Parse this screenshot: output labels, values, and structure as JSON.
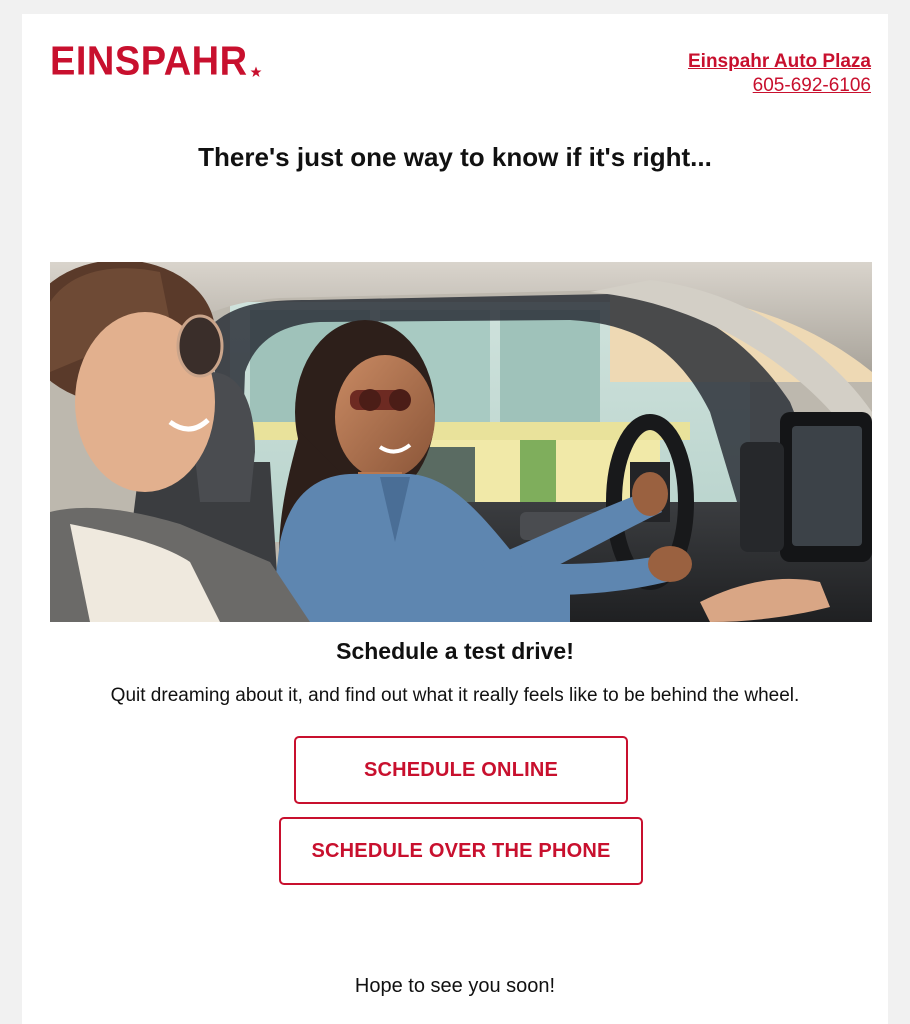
{
  "header": {
    "logo_text": "EINSPAHR",
    "dealer_name": "Einspahr Auto Plaza",
    "dealer_phone": "605-692-6106"
  },
  "headline": "There's just one way to know if it's right...",
  "hero": {
    "icon": "photo-women-driving-car"
  },
  "section": {
    "title": "Schedule a test drive!",
    "body": "Quit dreaming about it, and find out what it really feels like to be behind the wheel."
  },
  "buttons": {
    "schedule_online": "SCHEDULE ONLINE",
    "schedule_phone": "SCHEDULE OVER THE PHONE"
  },
  "closing": "Hope to see you soon!",
  "colors": {
    "brand_red": "#c8102e",
    "text": "#111111",
    "background": "#ffffff"
  }
}
